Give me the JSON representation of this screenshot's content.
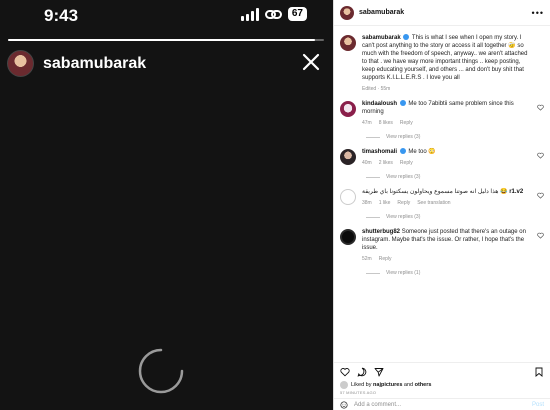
{
  "status_bar": {
    "time": "9:43",
    "battery": "67"
  },
  "story": {
    "username": "sabamubarak",
    "progress": 0.97
  },
  "post": {
    "username": "sabamubarak",
    "caption_user": "sabamubarak",
    "caption": "This is what I see when I open my story. I can't post anything to the story or access it all together 🤕 so much with the freedom of speech, anyway.. we aren't attached to that . we have way more important things .. keep posting, keep educating yourself, and others ... and don't buy shit that supports K.I.L.L.E.R.S . I love you all",
    "caption_meta": "Edited · 55m",
    "liked_by_prefix": "Liked by",
    "liked_by_user": "najpictures",
    "liked_by_suffix": "and",
    "liked_by_others": "others",
    "time_ago": "57 MINUTES AGO",
    "add_comment_placeholder": "Add a comment...",
    "post_label": "Post"
  },
  "comments": [
    {
      "user": "kindaaloush",
      "text": "Me too 7abibtii same problem since this morning",
      "time": "47m",
      "likes": "8 likes",
      "reply": "Reply",
      "view_replies": "View replies (3)"
    },
    {
      "user": "timashomali",
      "text": "Me too 😳",
      "time": "40m",
      "likes": "2 likes",
      "reply": "Reply",
      "view_replies": "View replies (3)"
    },
    {
      "user": "r1.v2",
      "text": "هذا دليل انه صوتنا مسموع ويحاولون يسكتونا باي طريقة 😂",
      "time": "38m",
      "likes": "1 like",
      "reply": "Reply",
      "see_translation": "See translation",
      "view_replies": "View replies (3)"
    },
    {
      "user": "shutterbug82",
      "text": "Someone just posted that there's an outage on instagram. Maybe that's the issue. Or rather, I hope that's the issue.",
      "time": "52m",
      "reply": "Reply",
      "view_replies": "View replies (1)"
    }
  ],
  "icons": {
    "more": "more-horizontal-icon",
    "heart": "heart-icon",
    "comment": "comment-icon",
    "share": "share-icon",
    "bookmark": "bookmark-icon",
    "emoji": "emoji-icon",
    "close": "close-icon"
  }
}
